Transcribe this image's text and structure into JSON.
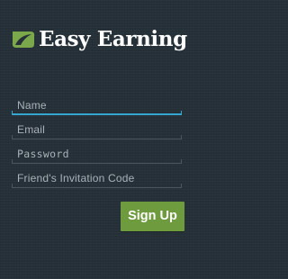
{
  "app": {
    "brand_name": "Easy Earning",
    "logo_icon": "leaf-icon"
  },
  "form": {
    "name_placeholder": "Name",
    "email_placeholder": "Email",
    "password_placeholder": "Password",
    "invitation_placeholder": "Friend's Invitation Code",
    "name_value": "",
    "email_value": "",
    "password_value": "",
    "invitation_value": "",
    "focused_field": "name"
  },
  "actions": {
    "signup_label": "Sign Up"
  },
  "colors": {
    "background": "#263038",
    "brand_green": "#6d9b3d",
    "focus_accent": "#35a6cf",
    "placeholder_text": "#a9b2b8"
  }
}
